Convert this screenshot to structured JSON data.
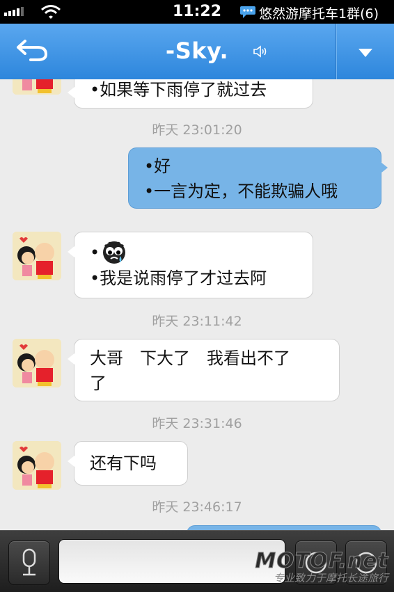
{
  "status_bar": {
    "time": "11:22",
    "notification": "悠然游摩托车1群(6)"
  },
  "nav": {
    "title": "-Sky."
  },
  "messages": [
    {
      "direction": "in",
      "lines": [
        "•如果等下雨停了就过去"
      ]
    },
    {
      "timestamp": "昨天 23:01:20"
    },
    {
      "direction": "out",
      "lines": [
        "•好",
        "•一言为定，不能欺骗人哦"
      ]
    },
    {
      "direction": "in",
      "lines": [
        "•",
        "•我是说雨停了才过去阿"
      ],
      "emoji": "crying-face"
    },
    {
      "timestamp": "昨天 23:11:42"
    },
    {
      "direction": "in",
      "lines": [
        "大哥　下大了　我看出不了",
        "了"
      ]
    },
    {
      "timestamp": "昨天 23:31:46"
    },
    {
      "direction": "in",
      "lines": [
        "还有下吗"
      ]
    },
    {
      "timestamp": "昨天 23:46:17"
    }
  ],
  "toolbar": {
    "input_value": ""
  },
  "watermark": {
    "title": "MOTOF.net",
    "subtitle": "专业致力于摩托长途旅行"
  },
  "colors": {
    "nav_blue": "#3a93e4",
    "outgoing_bubble": "#77b4e7",
    "incoming_bubble": "#ffffff",
    "chat_background": "#ececec",
    "timestamp_gray": "#a0a0a0"
  },
  "icons": [
    "signal-icon",
    "wifi-icon",
    "qq-chat-icon",
    "back-arrow-icon",
    "speaker-icon",
    "dropdown-triangle-icon",
    "microphone-icon",
    "emoji-icon",
    "more-icon"
  ]
}
